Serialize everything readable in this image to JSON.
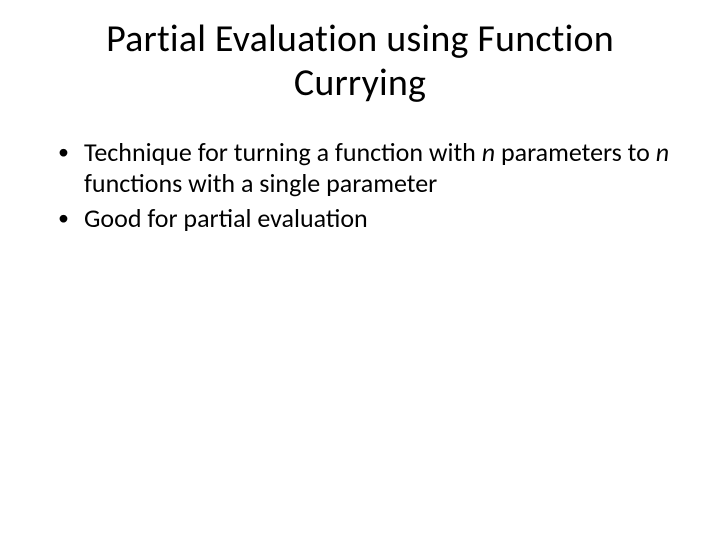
{
  "title": "Partial Evaluation using Function Currying",
  "bullets": [
    {
      "pre": "Technique for turning a function with ",
      "n1": "n",
      "mid": " parameters to ",
      "n2": "n",
      "post": " functions with a single parameter"
    },
    {
      "pre": "Good for partial evaluation",
      "n1": "",
      "mid": "",
      "n2": "",
      "post": ""
    }
  ]
}
